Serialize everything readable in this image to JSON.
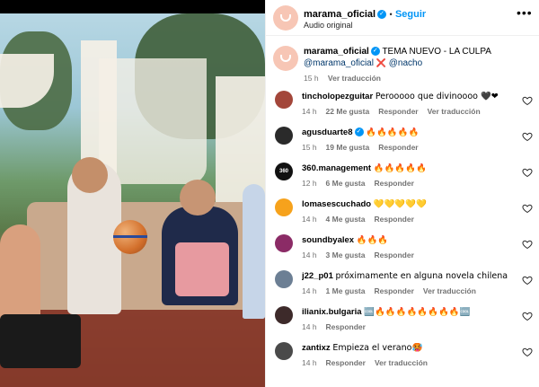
{
  "header": {
    "username": "marama_oficial",
    "follow_label": "Seguir",
    "audio_label": "Audio original",
    "more_label": "•••"
  },
  "caption": {
    "username": "marama_oficial",
    "text": "TEMA NUEVO - LA CULPA",
    "mention1": "@marama_oficial",
    "cross": "❌",
    "mention2": "@nacho",
    "time": "15 h",
    "translate_label": "Ver traducción"
  },
  "comments": [
    {
      "username": "tincholopezguitar",
      "verified": false,
      "text": "Perooooo que divinoooo 🖤❤",
      "time": "14 h",
      "likes": "22 Me gusta",
      "reply": "Responder",
      "translate": "Ver traducción",
      "avatar_color": "#a3463a"
    },
    {
      "username": "agusduarte8",
      "verified": true,
      "text": "🔥🔥🔥🔥🔥",
      "time": "15 h",
      "likes": "19 Me gusta",
      "reply": "Responder",
      "translate": "",
      "avatar_color": "#2a2a2a"
    },
    {
      "username": "360.management",
      "verified": false,
      "text": "🔥🔥🔥🔥🔥",
      "time": "12 h",
      "likes": "6 Me gusta",
      "reply": "Responder",
      "translate": "",
      "avatar_color": "#111111",
      "avatar_text": "360"
    },
    {
      "username": "lomasescuchado",
      "verified": false,
      "text": "💛💛💛💛💛",
      "time": "14 h",
      "likes": "4 Me gusta",
      "reply": "Responder",
      "translate": "",
      "avatar_color": "#f6a21c"
    },
    {
      "username": "soundbyalex",
      "verified": false,
      "text": "🔥🔥🔥",
      "time": "14 h",
      "likes": "3 Me gusta",
      "reply": "Responder",
      "translate": "",
      "avatar_color": "#8b2b66"
    },
    {
      "username": "j22_p01",
      "verified": false,
      "text": "próximamente en alguna novela chilena",
      "time": "14 h",
      "likes": "1 Me gusta",
      "reply": "Responder",
      "translate": "Ver traducción",
      "avatar_color": "#6c7f94"
    },
    {
      "username": "ilianix.bulgaria",
      "verified": false,
      "text": "🆒🔥🔥🔥🔥🔥🔥🔥🔥🆒",
      "time": "14 h",
      "likes": "",
      "reply": "Responder",
      "translate": "",
      "avatar_color": "#3d2a2a"
    },
    {
      "username": "zantixz",
      "verified": false,
      "text": "Empieza el verano🥵",
      "time": "14 h",
      "likes": "",
      "reply": "Responder",
      "translate": "Ver traducción",
      "avatar_color": "#4a4a4a"
    }
  ]
}
